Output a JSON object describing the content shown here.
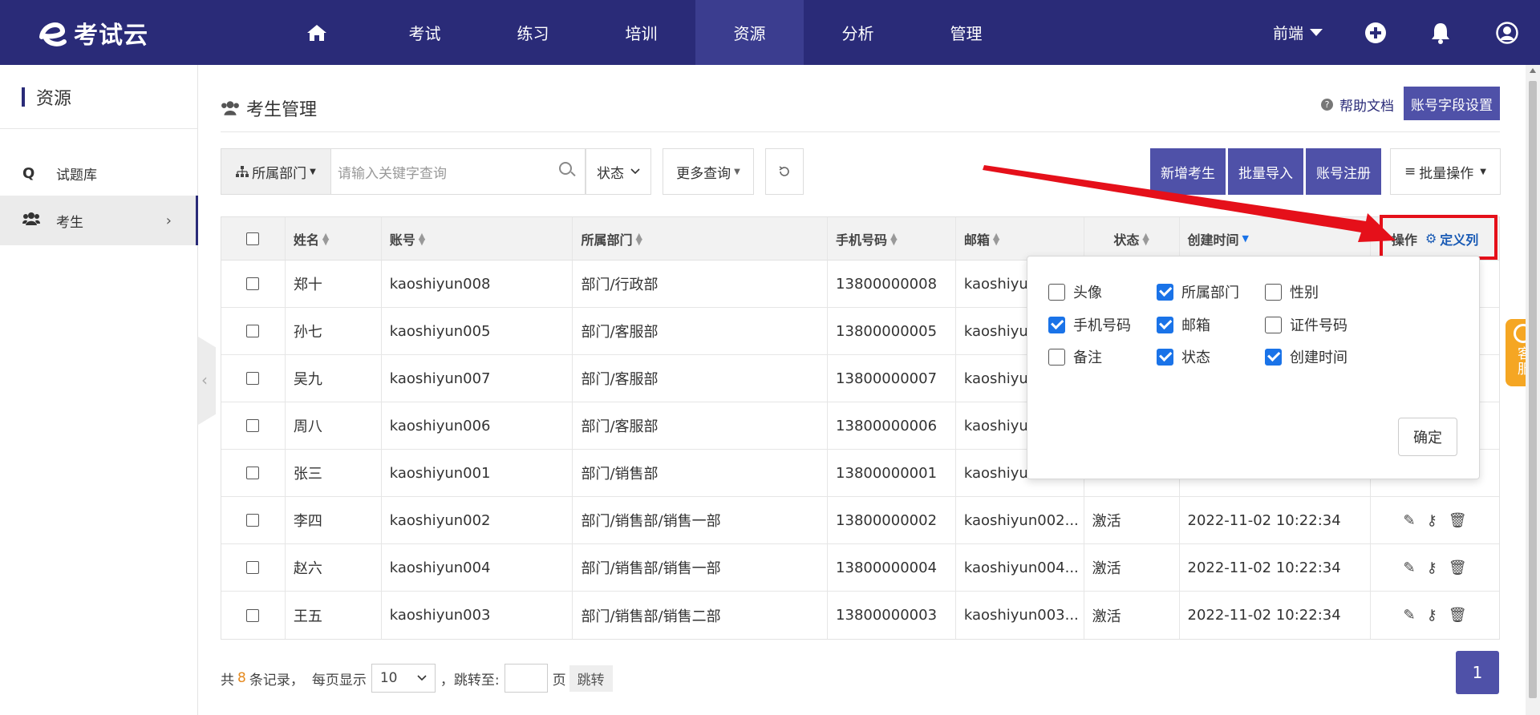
{
  "app": {
    "logo_text": "考试云"
  },
  "nav": {
    "items": [
      "考试",
      "练习",
      "培训",
      "资源",
      "分析",
      "管理"
    ],
    "active": "资源"
  },
  "user": {
    "name": "前端"
  },
  "sidebar": {
    "title": "资源",
    "items": [
      {
        "label": "试题库",
        "icon": "Q"
      },
      {
        "label": "考生"
      }
    ]
  },
  "page": {
    "title": "考生管理",
    "help_label": "帮助文档",
    "field_settings_label": "账号字段设置"
  },
  "filters": {
    "dept_label": "所属部门",
    "search_placeholder": "请输入关键字查询",
    "status_label": "状态",
    "more_label": "更多查询",
    "add_label": "新增考生",
    "import_label": "批量导入",
    "register_label": "账号注册",
    "batch_label": "批量操作"
  },
  "table": {
    "headers": {
      "name": "姓名",
      "account": "账号",
      "dept": "所属部门",
      "phone": "手机号码",
      "email": "邮箱",
      "status": "状态",
      "created": "创建时间",
      "op": "操作",
      "define_cols": "定义列"
    },
    "rows": [
      {
        "name": "郑十",
        "account": "kaoshiyun008",
        "dept": "部门/行政部",
        "phone": "13800000008",
        "email": "kaoshiyu",
        "status": "",
        "created": ""
      },
      {
        "name": "孙七",
        "account": "kaoshiyun005",
        "dept": "部门/客服部",
        "phone": "13800000005",
        "email": "kaoshiyu",
        "status": "",
        "created": ""
      },
      {
        "name": "吴九",
        "account": "kaoshiyun007",
        "dept": "部门/客服部",
        "phone": "13800000007",
        "email": "kaoshiyu",
        "status": "",
        "created": ""
      },
      {
        "name": "周八",
        "account": "kaoshiyun006",
        "dept": "部门/客服部",
        "phone": "13800000006",
        "email": "kaoshiyu",
        "status": "",
        "created": ""
      },
      {
        "name": "张三",
        "account": "kaoshiyun001",
        "dept": "部门/销售部",
        "phone": "13800000001",
        "email": "kaoshiyu",
        "status": "",
        "created": ""
      },
      {
        "name": "李四",
        "account": "kaoshiyun002",
        "dept": "部门/销售部/销售一部",
        "phone": "13800000002",
        "email": "kaoshiyun002...",
        "status": "激活",
        "created": "2022-11-02 10:22:34"
      },
      {
        "name": "赵六",
        "account": "kaoshiyun004",
        "dept": "部门/销售部/销售一部",
        "phone": "13800000004",
        "email": "kaoshiyun004...",
        "status": "激活",
        "created": "2022-11-02 10:22:34"
      },
      {
        "name": "王五",
        "account": "kaoshiyun003",
        "dept": "部门/销售部/销售二部",
        "phone": "13800000003",
        "email": "kaoshiyun003...",
        "status": "激活",
        "created": "2022-11-02 10:22:34"
      }
    ]
  },
  "column_picker": {
    "options": [
      {
        "label": "头像",
        "checked": false
      },
      {
        "label": "所属部门",
        "checked": true
      },
      {
        "label": "性别",
        "checked": false
      },
      {
        "label": "手机号码",
        "checked": true
      },
      {
        "label": "邮箱",
        "checked": true
      },
      {
        "label": "证件号码",
        "checked": false
      },
      {
        "label": "备注",
        "checked": false
      },
      {
        "label": "状态",
        "checked": true
      },
      {
        "label": "创建时间",
        "checked": true
      }
    ],
    "confirm_label": "确定"
  },
  "pagination": {
    "total_prefix": "共",
    "total": "8",
    "total_suffix": "条记录，",
    "per_page_label": "每页显示",
    "per_page": "10",
    "jump_label": "，跳转至:",
    "page_unit": "页",
    "jump_btn": "跳转",
    "current_page": "1"
  },
  "kefu": {
    "label": "客服"
  },
  "colors": {
    "brand": "#2a2b78",
    "primary_btn": "#4f51a8",
    "highlight": "#e5101a",
    "accent": "#f5a623"
  }
}
